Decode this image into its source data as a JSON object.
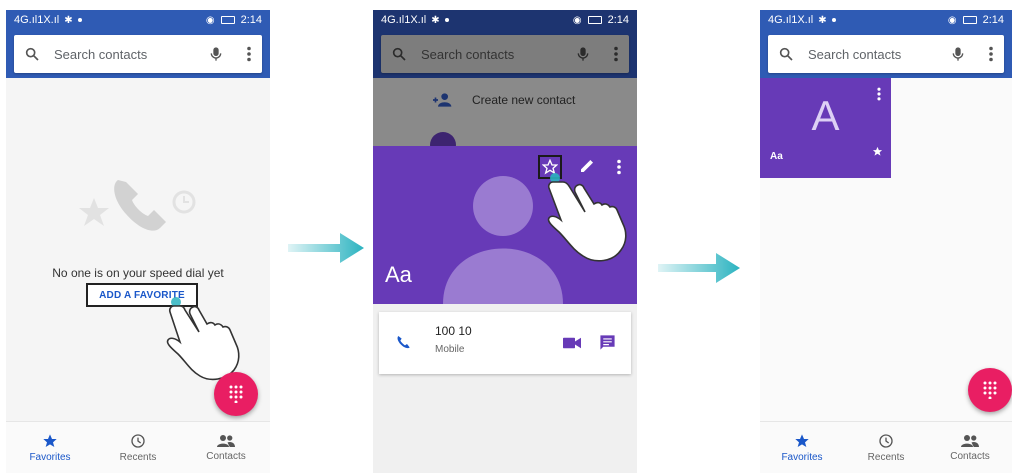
{
  "status_bar": {
    "network": "4G.ıl1X.ıl",
    "time": "2:14"
  },
  "search": {
    "placeholder": "Search contacts"
  },
  "bottom_nav": {
    "favorites": "Favorites",
    "recents": "Recents",
    "contacts": "Contacts"
  },
  "step1": {
    "empty_message": "No one is on your speed dial yet",
    "add_favorite": "ADD A FAVORITE"
  },
  "step2": {
    "create_new_contact": "Create new contact",
    "contact_name": "Aa",
    "phone_number": "100 10",
    "phone_type": "Mobile"
  },
  "step3": {
    "tile_initial": "A",
    "tile_name": "Aa"
  },
  "colors": {
    "app_bar": "#2f5bb4",
    "app_bar_dimmed": "#1d3470",
    "contact_purple": "#673ab7",
    "fab_pink": "#e91e63",
    "arrow_teal": "#2bb3c0",
    "accent_blue": "#1a57c9"
  },
  "icons": [
    "search-icon",
    "mic-icon",
    "more-vert-icon",
    "star-icon",
    "clock-icon",
    "people-icon",
    "dialpad-icon",
    "phone-icon",
    "video-icon",
    "message-icon",
    "edit-icon",
    "person-add-icon",
    "hand-pointer-icon",
    "arrow-right-icon"
  ]
}
